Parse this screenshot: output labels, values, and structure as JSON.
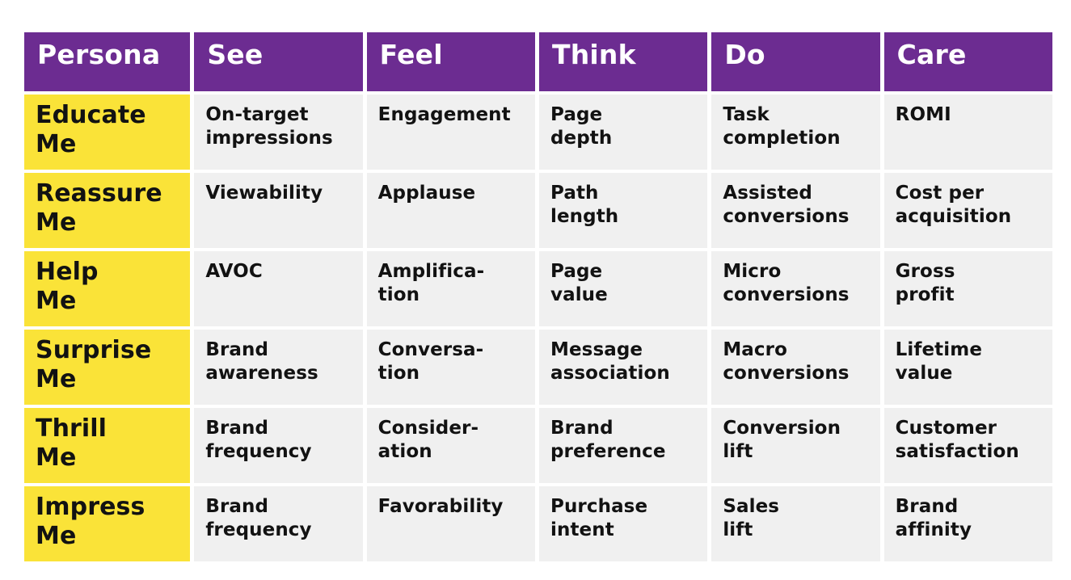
{
  "meta": {
    "accent_purple": "#6C2C91",
    "accent_yellow": "#FAE338",
    "cell_gray": "#F0F0F0",
    "text_dark": "#121212",
    "header_text": "#FFFFFF"
  },
  "table": {
    "columns": [
      {
        "key": "persona",
        "label": "Persona"
      },
      {
        "key": "see",
        "label": "See"
      },
      {
        "key": "feel",
        "label": "Feel"
      },
      {
        "key": "think",
        "label": "Think"
      },
      {
        "key": "do",
        "label": "Do"
      },
      {
        "key": "care",
        "label": "Care"
      }
    ],
    "rows": [
      {
        "persona": {
          "l1": "Educate",
          "l2": "Me"
        },
        "see": {
          "l1": "On-target",
          "l2": "impressions"
        },
        "feel": {
          "l1": "Engagement",
          "l2": ""
        },
        "think": {
          "l1": "Page",
          "l2": "depth"
        },
        "do": {
          "l1": "Task",
          "l2": "completion"
        },
        "care": {
          "l1": "ROMI",
          "l2": ""
        }
      },
      {
        "persona": {
          "l1": "Reassure",
          "l2": "Me"
        },
        "see": {
          "l1": "Viewability",
          "l2": ""
        },
        "feel": {
          "l1": "Applause",
          "l2": ""
        },
        "think": {
          "l1": "Path",
          "l2": "length"
        },
        "do": {
          "l1": "Assisted",
          "l2": "conversions"
        },
        "care": {
          "l1": "Cost per",
          "l2": "acquisition"
        }
      },
      {
        "persona": {
          "l1": "Help",
          "l2": "Me"
        },
        "see": {
          "l1": "AVOC",
          "l2": ""
        },
        "feel": {
          "l1": "Amplifica-",
          "l2": "tion"
        },
        "think": {
          "l1": "Page",
          "l2": "value"
        },
        "do": {
          "l1": "Micro",
          "l2": "conversions"
        },
        "care": {
          "l1": "Gross",
          "l2": "profit"
        }
      },
      {
        "persona": {
          "l1": "Surprise",
          "l2": "Me"
        },
        "see": {
          "l1": "Brand",
          "l2": "awareness"
        },
        "feel": {
          "l1": "Conversa-",
          "l2": "tion"
        },
        "think": {
          "l1": "Message",
          "l2": "association"
        },
        "do": {
          "l1": "Macro",
          "l2": "conversions"
        },
        "care": {
          "l1": "Lifetime",
          "l2": "value"
        }
      },
      {
        "persona": {
          "l1": "Thrill",
          "l2": "Me"
        },
        "see": {
          "l1": "Brand",
          "l2": "frequency"
        },
        "feel": {
          "l1": "Consider-",
          "l2": "ation"
        },
        "think": {
          "l1": "Brand",
          "l2": "preference"
        },
        "do": {
          "l1": "Conversion",
          "l2": "lift"
        },
        "care": {
          "l1": "Customer",
          "l2": "satisfaction"
        }
      },
      {
        "persona": {
          "l1": "Impress",
          "l2": "Me"
        },
        "see": {
          "l1": "Brand",
          "l2": "frequency"
        },
        "feel": {
          "l1": "Favorability",
          "l2": ""
        },
        "think": {
          "l1": "Purchase",
          "l2": "intent"
        },
        "do": {
          "l1": "Sales",
          "l2": "lift"
        },
        "care": {
          "l1": "Brand",
          "l2": "affinity"
        }
      }
    ]
  }
}
